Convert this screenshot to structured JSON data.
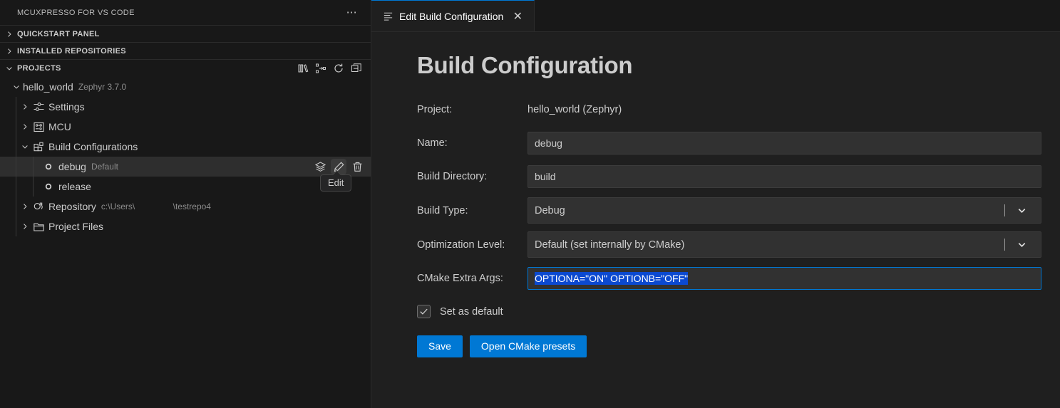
{
  "sidebar": {
    "title": "MCUXPRESSO FOR VS CODE",
    "more_label": "…",
    "sections": [
      {
        "label": "QUICKSTART PANEL",
        "expanded": false
      },
      {
        "label": "INSTALLED REPOSITORIES",
        "expanded": false
      },
      {
        "label": "PROJECTS",
        "expanded": true
      }
    ],
    "projects_actions": [
      {
        "name": "import-repository-icon",
        "title": "Import Repository"
      },
      {
        "name": "import-project-icon",
        "title": "Import Project"
      },
      {
        "name": "refresh-icon",
        "title": "Refresh"
      },
      {
        "name": "collapse-all-icon",
        "title": "Collapse All"
      }
    ],
    "tree": [
      {
        "label": "hello_world",
        "desc": "Zephyr 3.7.0",
        "icon": "",
        "twist": "down",
        "indent": 0
      },
      {
        "label": "Settings",
        "desc": "",
        "icon": "settings-sliders-icon",
        "twist": "right",
        "indent": 1
      },
      {
        "label": "MCU",
        "desc": "",
        "icon": "mcu-chip-icon",
        "twist": "right",
        "indent": 1
      },
      {
        "label": "Build Configurations",
        "desc": "",
        "icon": "build-configurations-icon",
        "twist": "down",
        "indent": 1
      },
      {
        "label": "debug",
        "desc": "Default",
        "icon": "circle-dot-icon",
        "twist": "none",
        "indent": 2,
        "selected": true
      },
      {
        "label": "release",
        "desc": "",
        "icon": "circle-dot-icon",
        "twist": "none",
        "indent": 2
      },
      {
        "label": "Repository",
        "desc": "c:\\Users\\                \\testrepo4",
        "icon": "repository-icon",
        "twist": "right",
        "indent": 1
      },
      {
        "label": "Project Files",
        "desc": "",
        "icon": "folder-icon",
        "twist": "right",
        "indent": 1
      }
    ],
    "row_actions": [
      {
        "name": "layers-icon",
        "title": "Build"
      },
      {
        "name": "pencil-edit-icon",
        "title": "Edit",
        "hovered": true
      },
      {
        "name": "trash-delete-icon",
        "title": "Delete"
      }
    ],
    "tooltip": "Edit"
  },
  "tab": {
    "label": "Edit Build Configuration",
    "close_label": "✕",
    "icon": "settings-editor-icon"
  },
  "page": {
    "title": "Build Configuration",
    "fields": {
      "project": {
        "label": "Project:",
        "value": "hello_world (Zephyr)"
      },
      "name": {
        "label": "Name:",
        "value": "debug",
        "placeholder": ""
      },
      "build_directory": {
        "label": "Build Directory:",
        "value": "build",
        "placeholder": ""
      },
      "build_type": {
        "label": "Build Type:",
        "value": "Debug"
      },
      "optimization_level": {
        "label": "Optimization Level:",
        "value": "Default (set internally by CMake)"
      },
      "cmake_extra_args": {
        "label": "CMake Extra Args:",
        "value": "OPTIONA=\"ON\" OPTIONB=\"OFF\"",
        "selected": true
      }
    },
    "checkbox": {
      "label": "Set as default",
      "checked": true
    },
    "buttons": [
      {
        "label": "Save",
        "name": "save-button"
      },
      {
        "label": "Open CMake presets",
        "name": "open-cmake-presets-button"
      }
    ]
  },
  "colors": {
    "accent": "#0078d4",
    "selection": "#0b49d0",
    "sidebar_bg": "#181818",
    "editor_bg": "#1f1f1f",
    "input_bg": "#313131"
  }
}
